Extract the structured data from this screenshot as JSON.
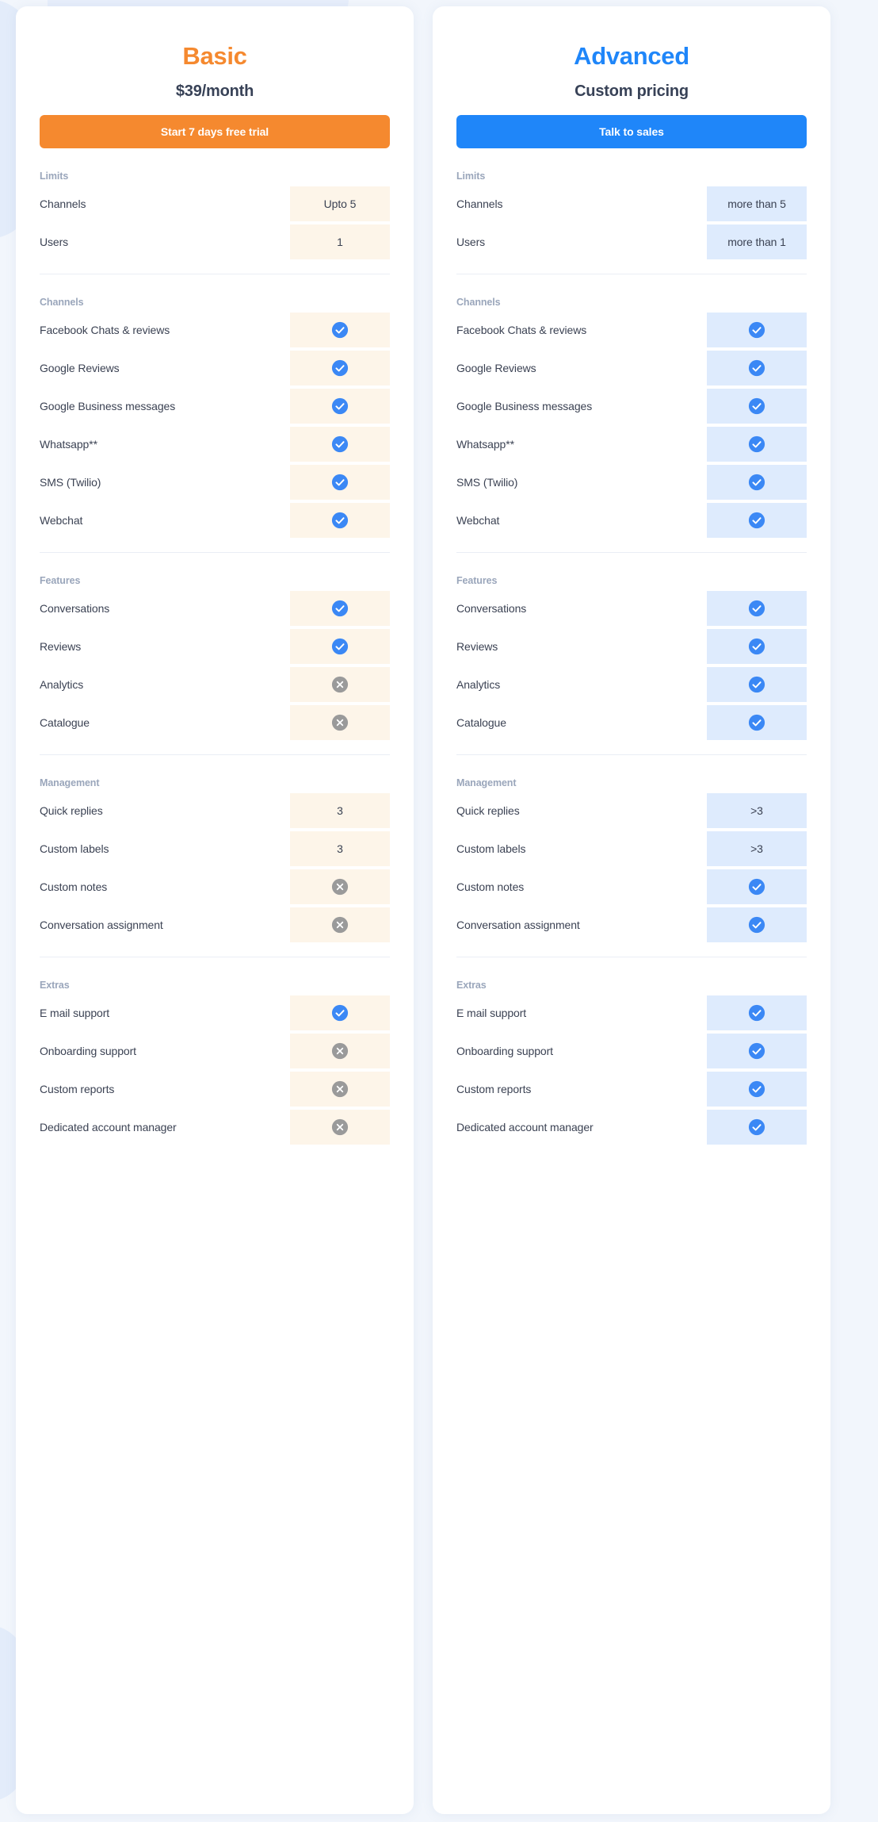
{
  "theme": {
    "basic_accent": "#f5892f",
    "advanced_accent": "#1f86f9",
    "basic_chip_bg": "#fdf5e9",
    "advanced_chip_bg": "#deebfd",
    "check_color": "#3b88f5",
    "cross_color": "#9a9a9a",
    "page_bg": "#f2f6fc"
  },
  "plans": [
    {
      "id": "basic",
      "name": "Basic",
      "price": "$39/month",
      "cta_label": "Start 7 days free trial",
      "sections": [
        {
          "title": "Limits",
          "rows": [
            {
              "label": "Channels",
              "type": "text",
              "value": "Upto 5"
            },
            {
              "label": "Users",
              "type": "text",
              "value": "1"
            }
          ]
        },
        {
          "title": "Channels",
          "rows": [
            {
              "label": "Facebook Chats & reviews",
              "type": "icon",
              "value": "check-icon"
            },
            {
              "label": "Google Reviews",
              "type": "icon",
              "value": "check-icon"
            },
            {
              "label": "Google Business messages",
              "type": "icon",
              "value": "check-icon"
            },
            {
              "label": "Whatsapp**",
              "type": "icon",
              "value": "check-icon"
            },
            {
              "label": "SMS (Twilio)",
              "type": "icon",
              "value": "check-icon"
            },
            {
              "label": "Webchat",
              "type": "icon",
              "value": "check-icon"
            }
          ]
        },
        {
          "title": "Features",
          "rows": [
            {
              "label": "Conversations",
              "type": "icon",
              "value": "check-icon"
            },
            {
              "label": "Reviews",
              "type": "icon",
              "value": "check-icon"
            },
            {
              "label": "Analytics",
              "type": "icon",
              "value": "cross-icon"
            },
            {
              "label": "Catalogue",
              "type": "icon",
              "value": "cross-icon"
            }
          ]
        },
        {
          "title": "Management",
          "rows": [
            {
              "label": "Quick replies",
              "type": "text",
              "value": "3"
            },
            {
              "label": "Custom labels",
              "type": "text",
              "value": "3"
            },
            {
              "label": "Custom notes",
              "type": "icon",
              "value": "cross-icon"
            },
            {
              "label": "Conversation assignment",
              "type": "icon",
              "value": "cross-icon"
            }
          ]
        },
        {
          "title": "Extras",
          "rows": [
            {
              "label": "E mail support",
              "type": "icon",
              "value": "check-icon"
            },
            {
              "label": "Onboarding support",
              "type": "icon",
              "value": "cross-icon"
            },
            {
              "label": "Custom reports",
              "type": "icon",
              "value": "cross-icon"
            },
            {
              "label": "Dedicated account manager",
              "type": "icon",
              "value": "cross-icon"
            }
          ]
        }
      ]
    },
    {
      "id": "advanced",
      "name": "Advanced",
      "price": "Custom pricing",
      "cta_label": "Talk to sales",
      "sections": [
        {
          "title": "Limits",
          "rows": [
            {
              "label": "Channels",
              "type": "text",
              "value": "more than 5"
            },
            {
              "label": "Users",
              "type": "text",
              "value": "more than 1"
            }
          ]
        },
        {
          "title": "Channels",
          "rows": [
            {
              "label": "Facebook Chats & reviews",
              "type": "icon",
              "value": "check-icon"
            },
            {
              "label": "Google Reviews",
              "type": "icon",
              "value": "check-icon"
            },
            {
              "label": "Google Business messages",
              "type": "icon",
              "value": "check-icon"
            },
            {
              "label": "Whatsapp**",
              "type": "icon",
              "value": "check-icon"
            },
            {
              "label": "SMS (Twilio)",
              "type": "icon",
              "value": "check-icon"
            },
            {
              "label": "Webchat",
              "type": "icon",
              "value": "check-icon"
            }
          ]
        },
        {
          "title": "Features",
          "rows": [
            {
              "label": "Conversations",
              "type": "icon",
              "value": "check-icon"
            },
            {
              "label": "Reviews",
              "type": "icon",
              "value": "check-icon"
            },
            {
              "label": "Analytics",
              "type": "icon",
              "value": "check-icon"
            },
            {
              "label": "Catalogue",
              "type": "icon",
              "value": "check-icon"
            }
          ]
        },
        {
          "title": "Management",
          "rows": [
            {
              "label": "Quick replies",
              "type": "text",
              "value": ">3"
            },
            {
              "label": "Custom labels",
              "type": "text",
              "value": ">3"
            },
            {
              "label": "Custom notes",
              "type": "icon",
              "value": "check-icon"
            },
            {
              "label": "Conversation assignment",
              "type": "icon",
              "value": "check-icon"
            }
          ]
        },
        {
          "title": "Extras",
          "rows": [
            {
              "label": "E mail support",
              "type": "icon",
              "value": "check-icon"
            },
            {
              "label": "Onboarding support",
              "type": "icon",
              "value": "check-icon"
            },
            {
              "label": "Custom reports",
              "type": "icon",
              "value": "check-icon"
            },
            {
              "label": "Dedicated account manager",
              "type": "icon",
              "value": "check-icon"
            }
          ]
        }
      ]
    }
  ]
}
